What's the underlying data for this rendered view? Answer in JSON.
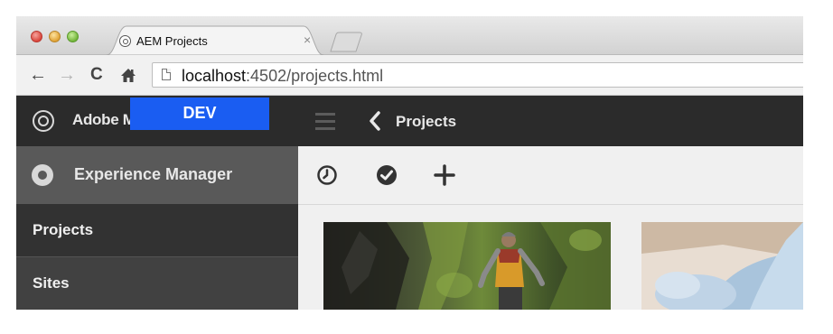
{
  "browser": {
    "tab_title": "AEM Projects",
    "tab_close": "×",
    "url_host": "localhost",
    "url_rest": ":4502/projects.html",
    "nav": {
      "back": "←",
      "forward": "→",
      "reload": "C"
    }
  },
  "rail": {
    "brand": "Adobe Marketing Cloud",
    "env_badge": "DEV",
    "product": "Experience Manager",
    "items": [
      {
        "label": "Projects",
        "active": true
      },
      {
        "label": "Sites",
        "active": false
      }
    ]
  },
  "header": {
    "breadcrumb": "Projects"
  },
  "actions": [
    "clock-icon",
    "check-circle-icon",
    "plus-icon"
  ],
  "colors": {
    "env_badge": "#1a5df2",
    "rail_dark": "#2b2b2b",
    "rail_sub": "#595959"
  }
}
